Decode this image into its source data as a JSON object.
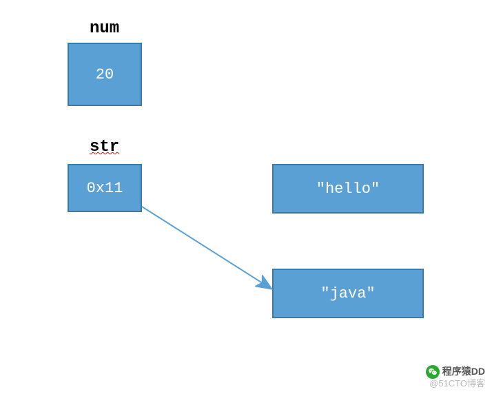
{
  "labels": {
    "num": "num",
    "str": "str"
  },
  "boxes": {
    "num_value": "20",
    "str_addr": "0x11",
    "hello": "\"hello\"",
    "java": "\"java\""
  },
  "watermark": {
    "main": "程序猿DD",
    "sub": "@51CTO博客"
  },
  "icons": {
    "wechat": "wechat-icon"
  }
}
